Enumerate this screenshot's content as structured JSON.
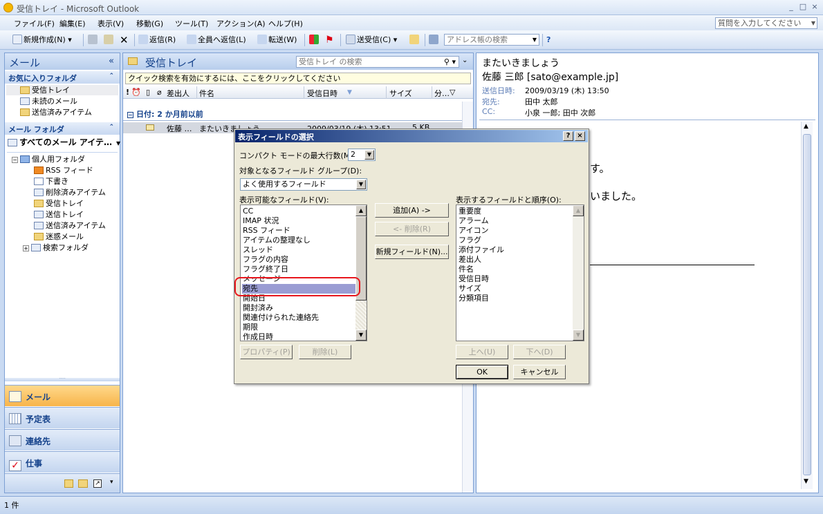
{
  "window": {
    "title": "受信トレイ - Microsoft Outlook",
    "min": "_",
    "max": "□",
    "close": "×"
  },
  "menu": [
    "ファイル(F)",
    "編集(E)",
    "表示(V)",
    "移動(G)",
    "ツール(T)",
    "アクション(A)",
    "ヘルプ(H)"
  ],
  "help_placeholder": "質問を入力してください",
  "toolbar": {
    "new": "新規作成(N)",
    "reply": "返信(R)",
    "reply_all": "全員へ返信(L)",
    "forward": "転送(W)",
    "send_receive": "送受信(C)",
    "address_search": "アドレス帳の検索"
  },
  "nav": {
    "title": "メール",
    "collapse": "«",
    "favorites_header": "お気に入りフォルダ",
    "favorites": [
      "受信トレイ",
      "未読のメール",
      "送信済みアイテム"
    ],
    "mail_folders_header": "メール フォルダ",
    "all_mail": "すべてのメール アイテ…",
    "tree_root": "個人用フォルダ",
    "tree": [
      "RSS フィード",
      "下書き",
      "削除済みアイテム",
      "受信トレイ",
      "送信トレイ",
      "送信済みアイテム",
      "迷惑メール",
      "検索フォルダ"
    ],
    "buttons": [
      "メール",
      "予定表",
      "連絡先",
      "仕事"
    ]
  },
  "inbox": {
    "title": "受信トレイ",
    "search_placeholder": "受信トレイ の検索",
    "quick_search": "クイック検索を有効にするには、ここをクリックしてください",
    "columns": {
      "from": "差出人",
      "subject": "件名",
      "received": "受信日時",
      "size": "サイズ",
      "category": "分…"
    },
    "group": "日付: 2 か月前以前",
    "row": {
      "from": "佐藤 …",
      "subject": "またいきましょう",
      "received": "2009/03/19 (木) 13:51",
      "size": "5 KB"
    }
  },
  "reading": {
    "subject": "またいきましょう",
    "sender": "佐藤 三郎 [sato@example.jp]",
    "sent_label": "送信日時:",
    "sent_value": "2009/03/19 (木) 13:50",
    "to_label": "宛先:",
    "to_value": "田中 太郎",
    "cc_label": "CC:",
    "cc_value": "小泉 一郎; 田中 次郎",
    "body_line1": "す。",
    "body_line2": "いました。"
  },
  "status": "1 件",
  "dialog": {
    "title": "表示フィールドの選択",
    "help_btn": "?",
    "close_btn": "×",
    "compact_label": "コンパクト モードの最大行数(M):",
    "compact_value": "2",
    "group_label": "対象となるフィールド グループ(D):",
    "group_value": "よく使用するフィールド",
    "available_label": "表示可能なフィールド(V):",
    "available": [
      "CC",
      "IMAP 状況",
      "RSS フィード",
      "アイテムの整理なし",
      "スレッド",
      "フラグの内容",
      "フラグ終了日",
      "メッセージ",
      "宛先",
      "開始日",
      "開封済み",
      "関連付けられた連絡先",
      "期限",
      "作成日時"
    ],
    "selected_index": 8,
    "shown_label": "表示するフィールドと順序(O):",
    "shown": [
      "重要度",
      "アラーム",
      "アイコン",
      "フラグ",
      "添付ファイル",
      "差出人",
      "件名",
      "受信日時",
      "サイズ",
      "分類項目"
    ],
    "btn_add": "追加(A) ->",
    "btn_remove": "<- 削除(R)",
    "btn_new": "新規フィールド(N)...",
    "btn_props": "プロパティ(P)",
    "btn_delete": "削除(L)",
    "btn_up": "上へ(U)",
    "btn_down": "下へ(D)",
    "btn_ok": "OK",
    "btn_cancel": "キャンセル"
  }
}
